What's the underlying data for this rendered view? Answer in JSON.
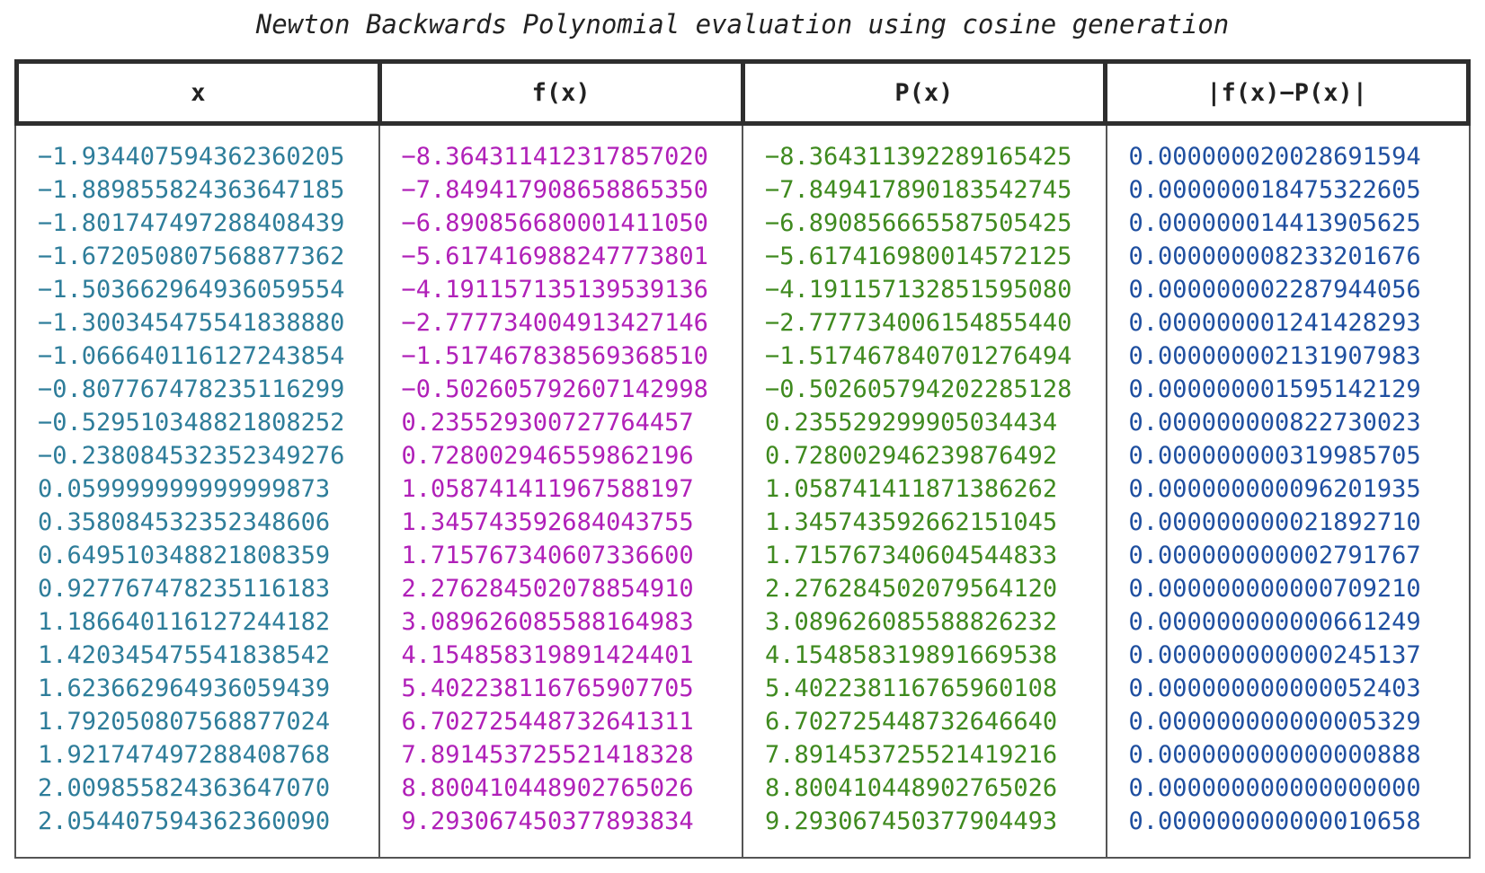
{
  "title": "Newton Backwards Polynomial evaluation using cosine generation",
  "colors": {
    "x": "#2e7d9a",
    "fx": "#b020b8",
    "px": "#3f8a1f",
    "err": "#1f4fa0"
  },
  "table": {
    "headers": [
      "x",
      "f(x)",
      "P(x)",
      "|f(x)−P(x)|"
    ],
    "x": [
      "−1.934407594362360205",
      "−1.889855824363647185",
      "−1.801747497288408439",
      "−1.672050807568877362",
      "−1.503662964936059554",
      "−1.300345475541838880",
      "−1.066640116127243854",
      "−0.807767478235116299",
      "−0.529510348821808252",
      "−0.238084532352349276",
      "0.059999999999999873",
      "0.358084532352348606",
      "0.649510348821808359",
      "0.927767478235116183",
      "1.186640116127244182",
      "1.420345475541838542",
      "1.623662964936059439",
      "1.792050807568877024",
      "1.921747497288408768",
      "2.009855824363647070",
      "2.054407594362360090"
    ],
    "fx": [
      "−8.364311412317857020",
      "−7.849417908658865350",
      "−6.890856680001411050",
      "−5.617416988247773801",
      "−4.191157135139539136",
      "−2.777734004913427146",
      "−1.517467838569368510",
      "−0.502605792607142998",
      "0.235529300727764457",
      "0.728002946559862196",
      "1.058741411967588197",
      "1.345743592684043755",
      "1.715767340607336600",
      "2.276284502078854910",
      "3.089626085588164983",
      "4.154858319891424401",
      "5.402238116765907705",
      "6.702725448732641311",
      "7.891453725521418328",
      "8.800410448902765026",
      "9.293067450377893834"
    ],
    "px": [
      "−8.364311392289165425",
      "−7.849417890183542745",
      "−6.890856665587505425",
      "−5.617416980014572125",
      "−4.191157132851595080",
      "−2.777734006154855440",
      "−1.517467840701276494",
      "−0.502605794202285128",
      "0.235529299905034434",
      "0.728002946239876492",
      "1.058741411871386262",
      "1.345743592662151045",
      "1.715767340604544833",
      "2.276284502079564120",
      "3.089626085588826232",
      "4.154858319891669538",
      "5.402238116765960108",
      "6.702725448732646640",
      "7.891453725521419216",
      "8.800410448902765026",
      "9.293067450377904493"
    ],
    "err": [
      "0.000000020028691594",
      "0.000000018475322605",
      "0.000000014413905625",
      "0.000000008233201676",
      "0.000000002287944056",
      "0.000000001241428293",
      "0.000000002131907983",
      "0.000000001595142129",
      "0.000000000822730023",
      "0.000000000319985705",
      "0.000000000096201935",
      "0.000000000021892710",
      "0.000000000002791767",
      "0.000000000000709210",
      "0.000000000000661249",
      "0.000000000000245137",
      "0.000000000000052403",
      "0.000000000000005329",
      "0.000000000000000888",
      "0.000000000000000000",
      "0.000000000000010658"
    ]
  }
}
